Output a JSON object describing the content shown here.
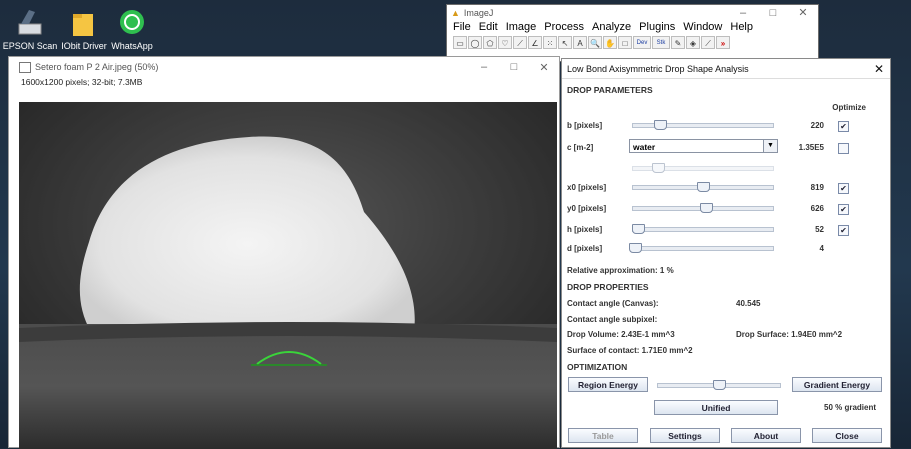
{
  "desktop": {
    "icons": [
      {
        "label": "EPSON Scan",
        "icon": "scanner-icon"
      },
      {
        "label": "IObit Driver",
        "icon": "folder-icon"
      },
      {
        "label": "WhatsApp",
        "icon": "whatsapp-icon"
      }
    ]
  },
  "imagej": {
    "title": "ImageJ",
    "menus": [
      "File",
      "Edit",
      "Image",
      "Process",
      "Analyze",
      "Plugins",
      "Window",
      "Help"
    ],
    "tools": [
      "▭",
      "◯",
      "⬠",
      "♡",
      "⟋",
      "∠",
      "⁙",
      "↖",
      "A",
      "🔍",
      "✋",
      "□",
      "Dev",
      "Stk",
      "✎",
      "◈",
      "⟋",
      "»"
    ]
  },
  "image_window": {
    "title": "Setero foam P 2 Air.jpeg (50%)",
    "info": "1600x1200 pixels; 32-bit; 7.3MB"
  },
  "dialog": {
    "title": "Low Bond Axisymmetric Drop Shape Analysis",
    "drop_parameters": {
      "heading": "DROP PARAMETERS",
      "optimize_label": "Optimize",
      "rows": [
        {
          "label": "b [pixels]",
          "value": "220",
          "checked": true,
          "slider": 0.2
        },
        {
          "label": "x0 [pixels]",
          "value": "819",
          "checked": true,
          "slider": 0.5
        },
        {
          "label": "y0 [pixels]",
          "value": "626",
          "checked": true,
          "slider": 0.52
        },
        {
          "label": "h [pixels]",
          "value": "52",
          "checked": true,
          "slider": 0.04
        },
        {
          "label": "d [pixels]",
          "value": "4",
          "checked": false,
          "slider": 0.02
        }
      ],
      "c_label": "c [m-2]",
      "c_select": "water",
      "c_value": "1.35E5",
      "c_checked": false,
      "c_slider": 0.18,
      "approx": "Relative approximation: 1 %"
    },
    "drop_properties": {
      "heading": "DROP PROPERTIES",
      "contact_angle_label": "Contact angle (Canvas):",
      "contact_angle_value": "40.545",
      "subpixel_label": "Contact angle subpixel:",
      "volume": "Drop Volume: 2.43E-1 mm^3",
      "surface": "Drop Surface: 1.94E0 mm^2",
      "contact_surface": "Surface of contact: 1.71E0 mm^2"
    },
    "optimization": {
      "heading": "OPTIMIZATION",
      "region_btn": "Region Energy",
      "gradient_btn": "Gradient Energy",
      "unified_btn": "Unified",
      "gradient_pct": "50 % gradient",
      "slider": 0.5
    },
    "buttons": {
      "table": "Table",
      "settings": "Settings",
      "about": "About",
      "close": "Close"
    }
  }
}
